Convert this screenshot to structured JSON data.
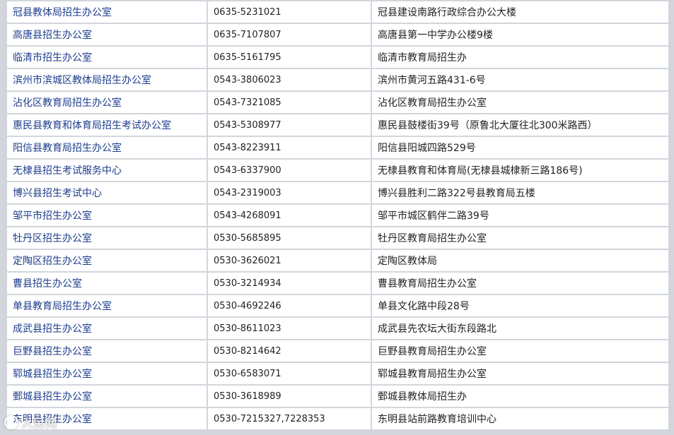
{
  "rows": [
    {
      "name": "冠县教体局招生办公室",
      "phone": "0635-5231021",
      "address": "冠县建设南路行政综合办公大楼"
    },
    {
      "name": "高唐县招生办公室",
      "phone": "0635-7107807",
      "address": "高唐县第一中学办公楼9楼"
    },
    {
      "name": "临清市招生办公室",
      "phone": "0635-5161795",
      "address": "临清市教育局招生办"
    },
    {
      "name": "滨州市滨城区教体局招生办公室",
      "phone": "0543-3806023",
      "address": "滨州市黄河五路431-6号"
    },
    {
      "name": "沾化区教育局招生办公室",
      "phone": "0543-7321085",
      "address": "沾化区教育局招生办公室"
    },
    {
      "name": "惠民县教育和体育局招生考试办公室",
      "phone": "0543-5308977",
      "address": "惠民县鼓楼街39号（原鲁北大厦往北300米路西）"
    },
    {
      "name": "阳信县教育局招生办公室",
      "phone": "0543-8223911",
      "address": "阳信县阳城四路529号"
    },
    {
      "name": "无棣县招生考试服务中心",
      "phone": "0543-6337900",
      "address": "无棣县教育和体育局(无棣县城棣新三路186号)"
    },
    {
      "name": "博兴县招生考试中心",
      "phone": "0543-2319003",
      "address": "博兴县胜利二路322号县教育局五楼"
    },
    {
      "name": "邹平市招生办公室",
      "phone": "0543-4268091",
      "address": "邹平市城区鹤伴二路39号"
    },
    {
      "name": "牡丹区招生办公室",
      "phone": "0530-5685895",
      "address": "牡丹区教育局招生办公室"
    },
    {
      "name": "定陶区招生办公室",
      "phone": "0530-3626021",
      "address": "定陶区教体局"
    },
    {
      "name": "曹县招生办公室",
      "phone": "0530-3214934",
      "address": "曹县教育局招生办公室"
    },
    {
      "name": "单县教育局招生办公室",
      "phone": "0530-4692246",
      "address": "单县文化路中段28号"
    },
    {
      "name": "成武县招生办公室",
      "phone": "0530-8611023",
      "address": "成武县先农坛大街东段路北"
    },
    {
      "name": "巨野县招生办公室",
      "phone": "0530-8214642",
      "address": "巨野县教育局招生办公室"
    },
    {
      "name": "郓城县招生办公室",
      "phone": "0530-6583071",
      "address": "郓城县教育局招生办公室"
    },
    {
      "name": "鄄城县招生办公室",
      "phone": "0530-3618989",
      "address": "鄄城县教体局招生办"
    },
    {
      "name": "东明县招生办公室",
      "phone": "0530-7215327,7228353",
      "address": "东明县站前路教育培训中心"
    }
  ],
  "watermark": "人民网"
}
